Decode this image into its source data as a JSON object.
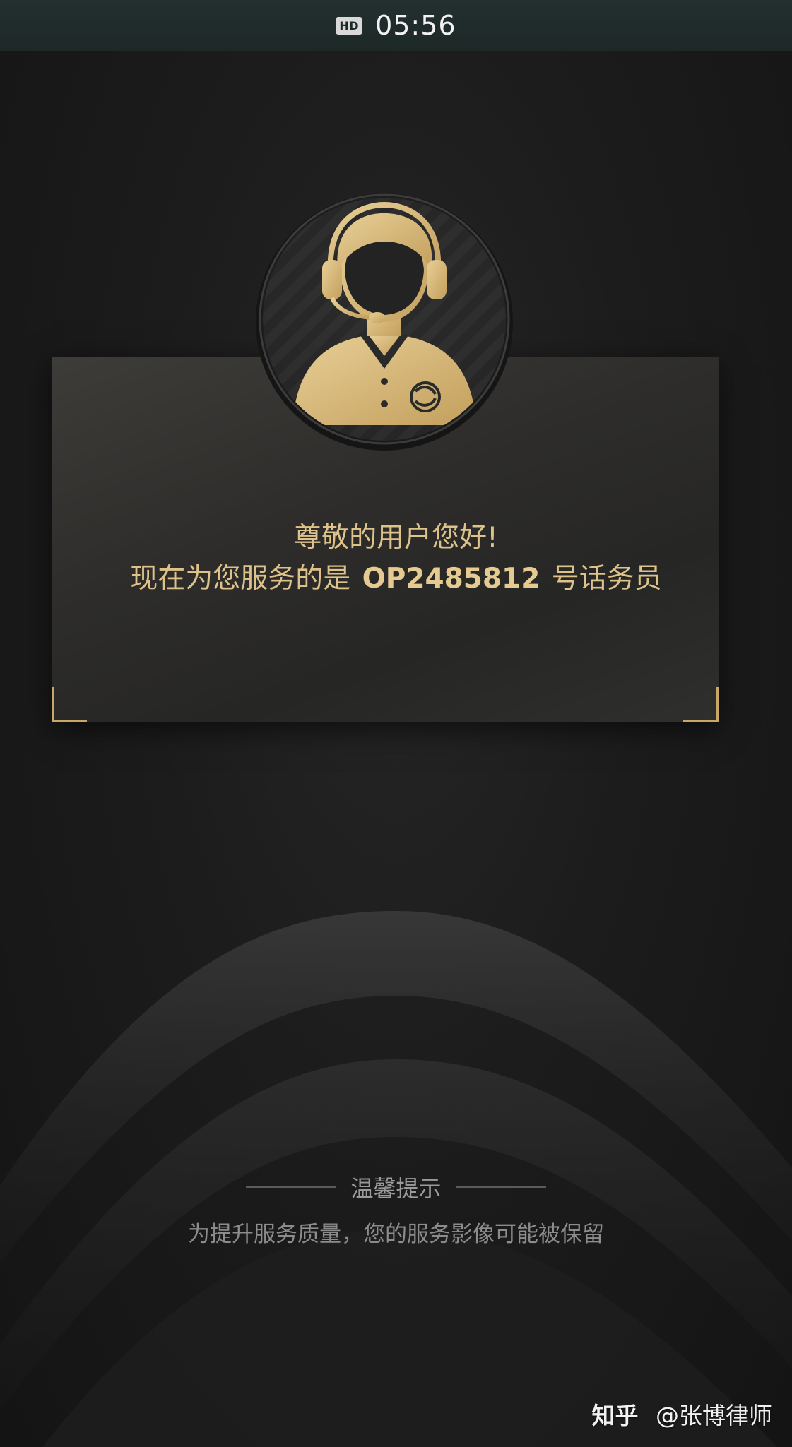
{
  "status_bar": {
    "hd_badge": "HD",
    "time": "05:56"
  },
  "greeting": {
    "line1": "尊敬的用户您好!",
    "line2_prefix": "现在为您服务的是",
    "operator_id": "OP2485812",
    "line2_suffix": "号话务员"
  },
  "tip": {
    "title": "温馨提示",
    "text": "为提升服务质量，您的服务影像可能被保留"
  },
  "watermark": {
    "brand": "知乎",
    "author": "@张博律师"
  },
  "colors": {
    "gold": "#ddc28a",
    "background": "#1c1c1c",
    "status_bar": "#23302f"
  },
  "icons": {
    "agent_avatar": "customer-service-agent-headset-icon",
    "logo": "china-mobile-logo-icon"
  }
}
